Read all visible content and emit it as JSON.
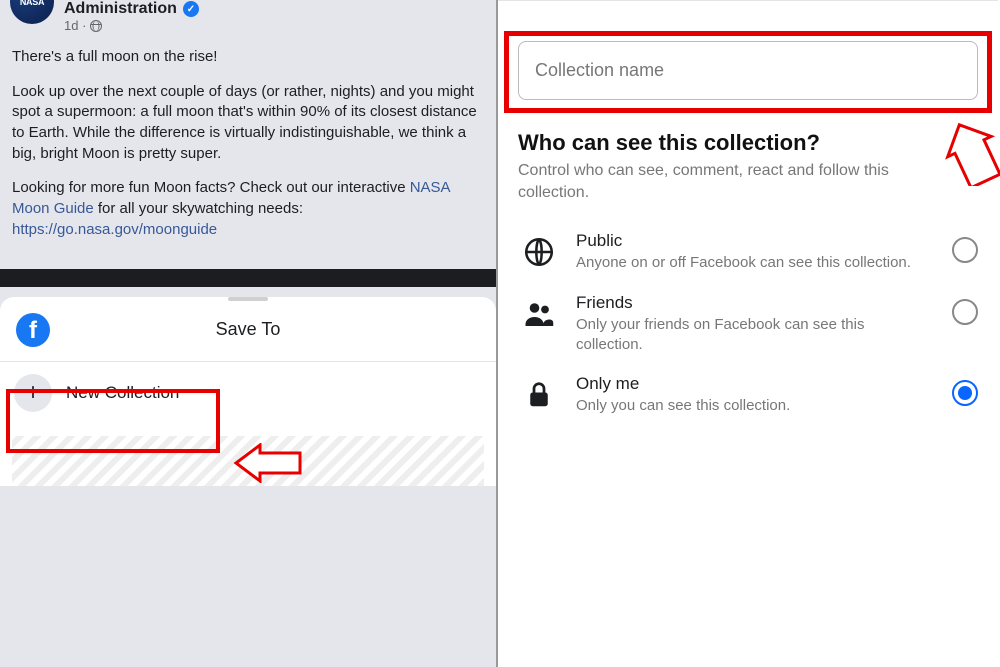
{
  "post": {
    "author": "Administration",
    "time": "1d ·",
    "text1": "There's a full moon on the rise!",
    "text2a": "Look up over the next couple of days (or rather, nights) and you might spot a supermoon: a full moon that's within 90% of its closest distance to Earth. While the difference is virtually indistinguishable, we think a big, bright Moon is pretty super.",
    "text3a": "Looking for more fun Moon facts? Check out our interactive ",
    "link1": "NASA Moon Guide",
    "text3b": " for all your skywatching needs: ",
    "link2": "https://go.nasa.gov/moonguide"
  },
  "saveSheet": {
    "title": "Save To",
    "newCollection": "New Collection"
  },
  "collectionForm": {
    "placeholder": "Collection name",
    "heading": "Who can see this collection?",
    "subheading": "Control who can see, comment, react and follow this collection."
  },
  "privacy": {
    "public": {
      "title": "Public",
      "desc": "Anyone on or off Facebook can see this collection."
    },
    "friends": {
      "title": "Friends",
      "desc": "Only your friends on Facebook can see this collection."
    },
    "onlyme": {
      "title": "Only me",
      "desc": "Only you can see this collection."
    }
  }
}
